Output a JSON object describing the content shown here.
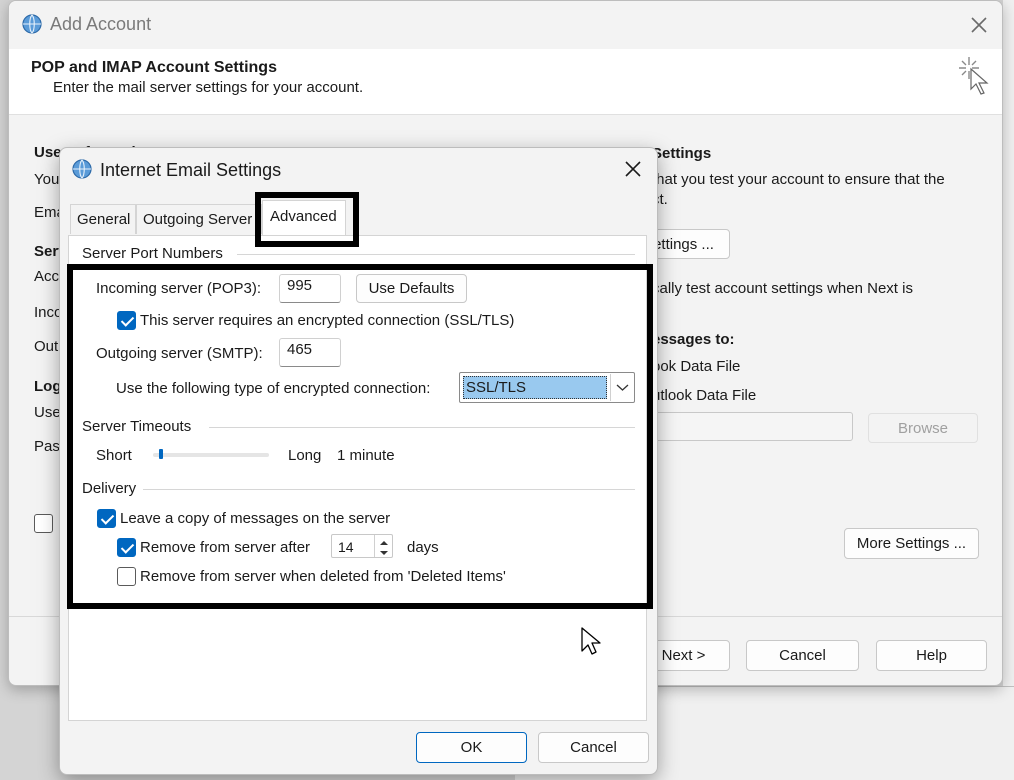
{
  "background_window": {
    "title": "Add Account",
    "heading": "POP and IMAP Account Settings",
    "subheading": "Enter the mail server settings for your account.",
    "left_fragments": [
      "User Information",
      "You",
      "Ema",
      "Server",
      "Acc",
      "Inco",
      "Out",
      "Log",
      "Use",
      "Pass"
    ],
    "right_section_title": "Settings",
    "right_text_1": "that you test your account to ensure that the",
    "right_text_2": "ct.",
    "test_settings_button": "ettings ...",
    "auto_test_text": "cally test account settings when Next is",
    "deliver_label": "essages to:",
    "new_data_file": "ook Data File",
    "existing_data_file": "utlook Data File",
    "browse_button": "Browse",
    "more_settings_button": "More Settings ...",
    "next_button": "Next >",
    "cancel_button": "Cancel",
    "help_button": "Help"
  },
  "dialog": {
    "title": "Internet Email Settings",
    "tabs": [
      "General",
      "Outgoing Server",
      "Advanced"
    ],
    "active_tab": "Advanced",
    "server_ports": {
      "section_title": "Server Port Numbers",
      "incoming_label": "Incoming server (POP3):",
      "incoming_value": "995",
      "use_defaults_button": "Use Defaults",
      "encrypted_label": "This server requires an encrypted connection (SSL/TLS)",
      "encrypted_checked": true,
      "outgoing_label": "Outgoing server (SMTP):",
      "outgoing_value": "465",
      "encryption_type_label": "Use the following type of encrypted connection:",
      "encryption_type_value": "SSL/TLS"
    },
    "timeouts": {
      "section_title": "Server Timeouts",
      "short_label": "Short",
      "long_label": "Long",
      "value_label": "1 minute",
      "slider_fraction": 0.05
    },
    "delivery": {
      "section_title": "Delivery",
      "leave_copy_label": "Leave a copy of messages on the server",
      "leave_copy_checked": true,
      "remove_after_label": "Remove from server after",
      "remove_after_checked": true,
      "remove_after_days": "14",
      "days_label": "days",
      "remove_deleted_label": "Remove from server when deleted from 'Deleted Items'",
      "remove_deleted_checked": false
    },
    "ok_button": "OK",
    "cancel_button": "Cancel"
  },
  "colors": {
    "accent": "#0067c0",
    "highlight": "#99c9ef",
    "annotation": "#000000"
  }
}
